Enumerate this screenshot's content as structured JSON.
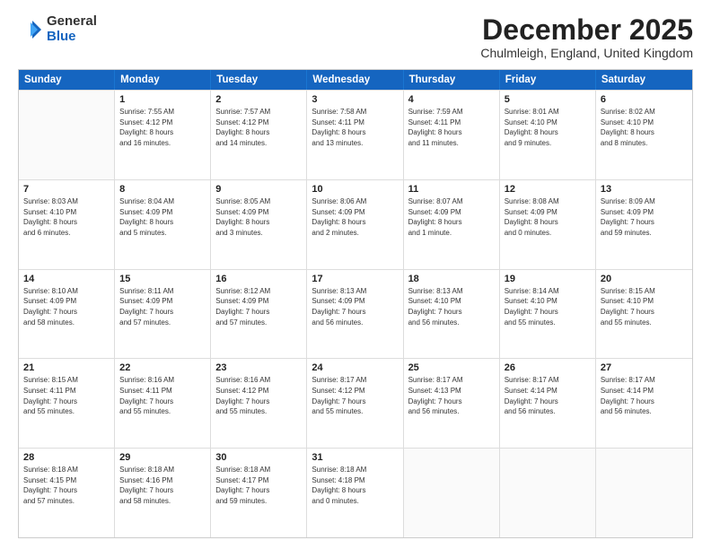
{
  "logo": {
    "general": "General",
    "blue": "Blue"
  },
  "title": "December 2025",
  "location": "Chulmleigh, England, United Kingdom",
  "header_days": [
    "Sunday",
    "Monday",
    "Tuesday",
    "Wednesday",
    "Thursday",
    "Friday",
    "Saturday"
  ],
  "weeks": [
    [
      {
        "day": "",
        "detail": ""
      },
      {
        "day": "1",
        "detail": "Sunrise: 7:55 AM\nSunset: 4:12 PM\nDaylight: 8 hours\nand 16 minutes."
      },
      {
        "day": "2",
        "detail": "Sunrise: 7:57 AM\nSunset: 4:12 PM\nDaylight: 8 hours\nand 14 minutes."
      },
      {
        "day": "3",
        "detail": "Sunrise: 7:58 AM\nSunset: 4:11 PM\nDaylight: 8 hours\nand 13 minutes."
      },
      {
        "day": "4",
        "detail": "Sunrise: 7:59 AM\nSunset: 4:11 PM\nDaylight: 8 hours\nand 11 minutes."
      },
      {
        "day": "5",
        "detail": "Sunrise: 8:01 AM\nSunset: 4:10 PM\nDaylight: 8 hours\nand 9 minutes."
      },
      {
        "day": "6",
        "detail": "Sunrise: 8:02 AM\nSunset: 4:10 PM\nDaylight: 8 hours\nand 8 minutes."
      }
    ],
    [
      {
        "day": "7",
        "detail": "Sunrise: 8:03 AM\nSunset: 4:10 PM\nDaylight: 8 hours\nand 6 minutes."
      },
      {
        "day": "8",
        "detail": "Sunrise: 8:04 AM\nSunset: 4:09 PM\nDaylight: 8 hours\nand 5 minutes."
      },
      {
        "day": "9",
        "detail": "Sunrise: 8:05 AM\nSunset: 4:09 PM\nDaylight: 8 hours\nand 3 minutes."
      },
      {
        "day": "10",
        "detail": "Sunrise: 8:06 AM\nSunset: 4:09 PM\nDaylight: 8 hours\nand 2 minutes."
      },
      {
        "day": "11",
        "detail": "Sunrise: 8:07 AM\nSunset: 4:09 PM\nDaylight: 8 hours\nand 1 minute."
      },
      {
        "day": "12",
        "detail": "Sunrise: 8:08 AM\nSunset: 4:09 PM\nDaylight: 8 hours\nand 0 minutes."
      },
      {
        "day": "13",
        "detail": "Sunrise: 8:09 AM\nSunset: 4:09 PM\nDaylight: 7 hours\nand 59 minutes."
      }
    ],
    [
      {
        "day": "14",
        "detail": "Sunrise: 8:10 AM\nSunset: 4:09 PM\nDaylight: 7 hours\nand 58 minutes."
      },
      {
        "day": "15",
        "detail": "Sunrise: 8:11 AM\nSunset: 4:09 PM\nDaylight: 7 hours\nand 57 minutes."
      },
      {
        "day": "16",
        "detail": "Sunrise: 8:12 AM\nSunset: 4:09 PM\nDaylight: 7 hours\nand 57 minutes."
      },
      {
        "day": "17",
        "detail": "Sunrise: 8:13 AM\nSunset: 4:09 PM\nDaylight: 7 hours\nand 56 minutes."
      },
      {
        "day": "18",
        "detail": "Sunrise: 8:13 AM\nSunset: 4:10 PM\nDaylight: 7 hours\nand 56 minutes."
      },
      {
        "day": "19",
        "detail": "Sunrise: 8:14 AM\nSunset: 4:10 PM\nDaylight: 7 hours\nand 55 minutes."
      },
      {
        "day": "20",
        "detail": "Sunrise: 8:15 AM\nSunset: 4:10 PM\nDaylight: 7 hours\nand 55 minutes."
      }
    ],
    [
      {
        "day": "21",
        "detail": "Sunrise: 8:15 AM\nSunset: 4:11 PM\nDaylight: 7 hours\nand 55 minutes."
      },
      {
        "day": "22",
        "detail": "Sunrise: 8:16 AM\nSunset: 4:11 PM\nDaylight: 7 hours\nand 55 minutes."
      },
      {
        "day": "23",
        "detail": "Sunrise: 8:16 AM\nSunset: 4:12 PM\nDaylight: 7 hours\nand 55 minutes."
      },
      {
        "day": "24",
        "detail": "Sunrise: 8:17 AM\nSunset: 4:12 PM\nDaylight: 7 hours\nand 55 minutes."
      },
      {
        "day": "25",
        "detail": "Sunrise: 8:17 AM\nSunset: 4:13 PM\nDaylight: 7 hours\nand 56 minutes."
      },
      {
        "day": "26",
        "detail": "Sunrise: 8:17 AM\nSunset: 4:14 PM\nDaylight: 7 hours\nand 56 minutes."
      },
      {
        "day": "27",
        "detail": "Sunrise: 8:17 AM\nSunset: 4:14 PM\nDaylight: 7 hours\nand 56 minutes."
      }
    ],
    [
      {
        "day": "28",
        "detail": "Sunrise: 8:18 AM\nSunset: 4:15 PM\nDaylight: 7 hours\nand 57 minutes."
      },
      {
        "day": "29",
        "detail": "Sunrise: 8:18 AM\nSunset: 4:16 PM\nDaylight: 7 hours\nand 58 minutes."
      },
      {
        "day": "30",
        "detail": "Sunrise: 8:18 AM\nSunset: 4:17 PM\nDaylight: 7 hours\nand 59 minutes."
      },
      {
        "day": "31",
        "detail": "Sunrise: 8:18 AM\nSunset: 4:18 PM\nDaylight: 8 hours\nand 0 minutes."
      },
      {
        "day": "",
        "detail": ""
      },
      {
        "day": "",
        "detail": ""
      },
      {
        "day": "",
        "detail": ""
      }
    ]
  ]
}
